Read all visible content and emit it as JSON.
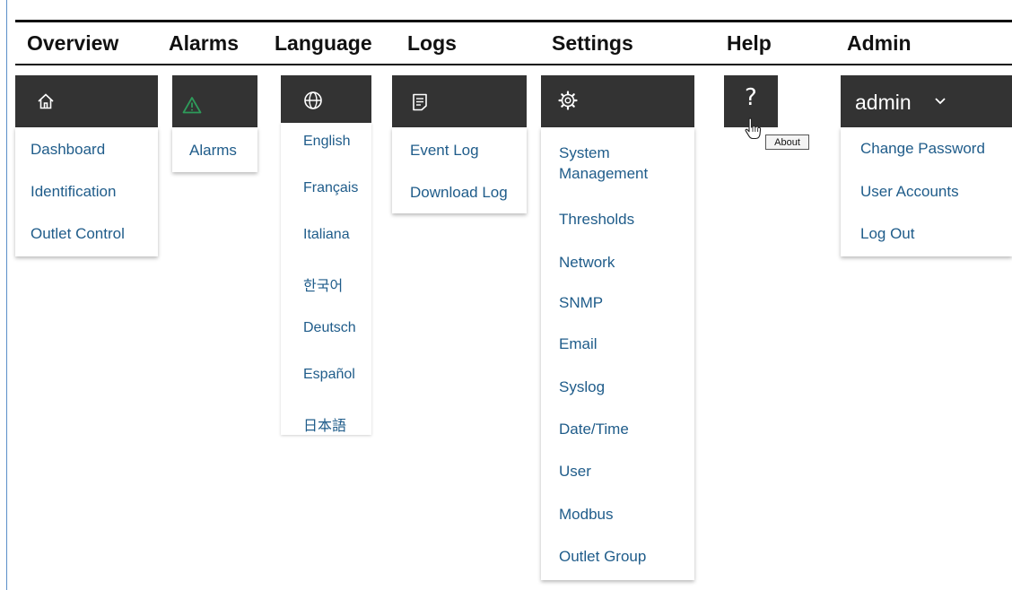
{
  "headings": {
    "overview": "Overview",
    "alarms": "Alarms",
    "language": "Language",
    "logs": "Logs",
    "settings": "Settings",
    "help": "Help",
    "admin": "Admin"
  },
  "icons": {
    "overview": "home-icon",
    "alarms": "warning-triangle-icon",
    "language": "globe-icon",
    "logs": "document-icon",
    "settings": "gear-icon",
    "help": "question-icon",
    "admin": "chevron-down-icon"
  },
  "colors": {
    "bar": "#333333",
    "link": "#1f5c8a",
    "alarm_icon": "#2e9a5a"
  },
  "overview_menu": [
    "Dashboard",
    "Identification",
    "Outlet Control"
  ],
  "alarms_menu": [
    "Alarms"
  ],
  "language_menu": [
    "English",
    "Français",
    "Italiana",
    "한국어",
    "Deutsch",
    "Español",
    "日本語"
  ],
  "logs_menu": [
    "Event Log",
    "Download Log"
  ],
  "settings_menu": [
    "System Management",
    "Thresholds",
    "Network",
    "SNMP",
    "Email",
    "Syslog",
    "Date/Time",
    "User",
    "Modbus",
    "Outlet Group"
  ],
  "help": {
    "icon_glyph": "?",
    "tooltip": "About"
  },
  "admin": {
    "username": "admin",
    "menu": [
      "Change Password",
      "User Accounts",
      "Log Out"
    ]
  }
}
